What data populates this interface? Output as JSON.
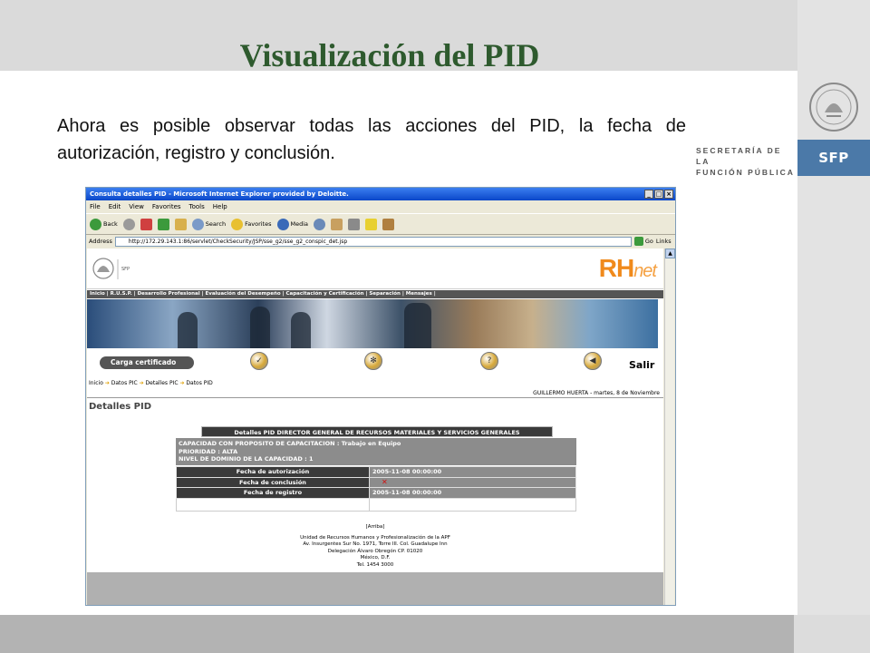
{
  "slide": {
    "title": "Visualización del PID",
    "body": "Ahora es posible observar todas las acciones del PID, la fecha de autorización, registro y conclusión.",
    "org_name_line1": "SECRETARÍA DE LA",
    "org_name_line2": "FUNCIÓN PÚBLICA",
    "org_abbrev": "SFP"
  },
  "browser": {
    "window_title": "Consulta detalles PID - Microsoft Internet Explorer provided by Deloitte.",
    "menu": [
      "File",
      "Edit",
      "View",
      "Favorites",
      "Tools",
      "Help"
    ],
    "toolbar": {
      "back": "Back",
      "search": "Search",
      "favorites": "Favorites",
      "media": "Media"
    },
    "address_label": "Address",
    "address_url": "http://172.29.143.1:86/servlet/CheckSecurity/JSP/sse_g2/sse_g2_conspic_det.jsp",
    "go_label": "Go",
    "links_label": "Links"
  },
  "page": {
    "brand": "RH",
    "brand_suffix": "net",
    "logo_caption": "SECRETARÍA DE LA FUNCIÓN PÚBLICA | SFP",
    "nav": "Inicio | R.U.S.P. | Desarrollo Profesional | Evaluación del Desempeño | Capacitación y Certificación | Separación | Mensajes |",
    "carga_button": "Carga certificado",
    "salir": "Salir",
    "breadcrumb": [
      "Inicio",
      "Datos PIC",
      "Detalles PIC",
      "Datos PID"
    ],
    "user_line": "GUILLERMO HUERTA - martes, 8 de Noviembre",
    "heading": "Detalles PID",
    "details_title": "Detalles PID  DIRECTOR GENERAL DE RECURSOS MATERIALES Y SERVICIOS GENERALES",
    "capacidad_line1": "CAPACIDAD CON PROPOSITO DE CAPACITACION : Trabajo en Equipo",
    "capacidad_line2": "PRIORIDAD : ALTA",
    "capacidad_line3": "NIVEL DE DOMINIO DE LA CAPACIDAD : 1",
    "rows": [
      {
        "label": "Fecha de autorización",
        "value": "2005-11-08 00:00:00"
      },
      {
        "label": "Fecha de conclusión",
        "value": ""
      },
      {
        "label": "Fecha de registro",
        "value": "2005-11-08 00:00:00"
      }
    ],
    "footer": {
      "arriba": "[Arriba]",
      "line1": "Unidad de Recursos Humanos y Profesionalización de la APF",
      "line2": "Av. Insurgentes Sur No. 1971, Torre III. Col. Guadalupe Inn",
      "line3": "Delegación Álvaro Obregón CP. 01020",
      "line4": "México, D.F.",
      "line5": "Tel. 1454 3000"
    }
  }
}
